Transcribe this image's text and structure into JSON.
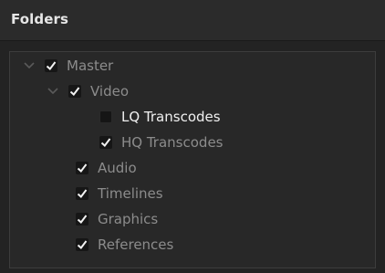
{
  "panel": {
    "title": "Folders"
  },
  "tree": {
    "items": [
      {
        "label": "Master",
        "checked": true,
        "expanded": true
      },
      {
        "label": "Video",
        "checked": true,
        "expanded": true
      },
      {
        "label": "LQ Transcodes",
        "checked": false
      },
      {
        "label": "HQ Transcodes",
        "checked": true
      },
      {
        "label": "Audio",
        "checked": true
      },
      {
        "label": "Timelines",
        "checked": true
      },
      {
        "label": "Graphics",
        "checked": true
      },
      {
        "label": "References",
        "checked": true
      }
    ]
  },
  "icons": {
    "expand": "chevron-down-icon",
    "check": "checkmark-icon"
  },
  "colors": {
    "panel_bg": "#232323",
    "header_bg": "#2b2b2b",
    "tree_bg": "#282828",
    "label_dim": "#8c8c8c",
    "label_active": "#f0f0f0"
  }
}
